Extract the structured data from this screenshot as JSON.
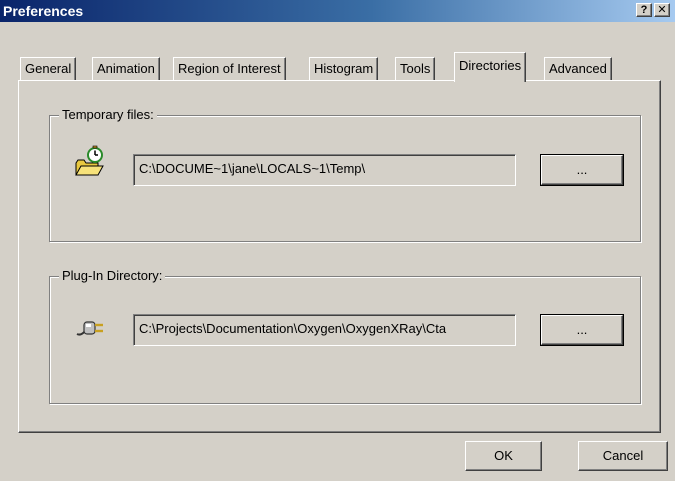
{
  "window": {
    "title": "Preferences",
    "help_glyph": "?",
    "close_glyph": "✕"
  },
  "tabs": [
    {
      "label": "General",
      "active": false
    },
    {
      "label": "Animation",
      "active": false
    },
    {
      "label": "Region of Interest",
      "active": false
    },
    {
      "label": "Histogram",
      "active": false
    },
    {
      "label": "Tools",
      "active": false
    },
    {
      "label": "Directories",
      "active": true
    },
    {
      "label": "Advanced",
      "active": false
    }
  ],
  "temp_files": {
    "legend": "Temporary files:",
    "icon": "folder-clock-icon",
    "path": "C:\\DOCUME~1\\jane\\LOCALS~1\\Temp\\",
    "browse_label": "..."
  },
  "plugin_dir": {
    "legend": "Plug-In Directory:",
    "icon": "plug-icon",
    "path": "C:\\Projects\\Documentation\\Oxygen\\OxygenXRay\\Cta",
    "browse_label": "..."
  },
  "dialog": {
    "ok_label": "OK",
    "cancel_label": "Cancel"
  }
}
